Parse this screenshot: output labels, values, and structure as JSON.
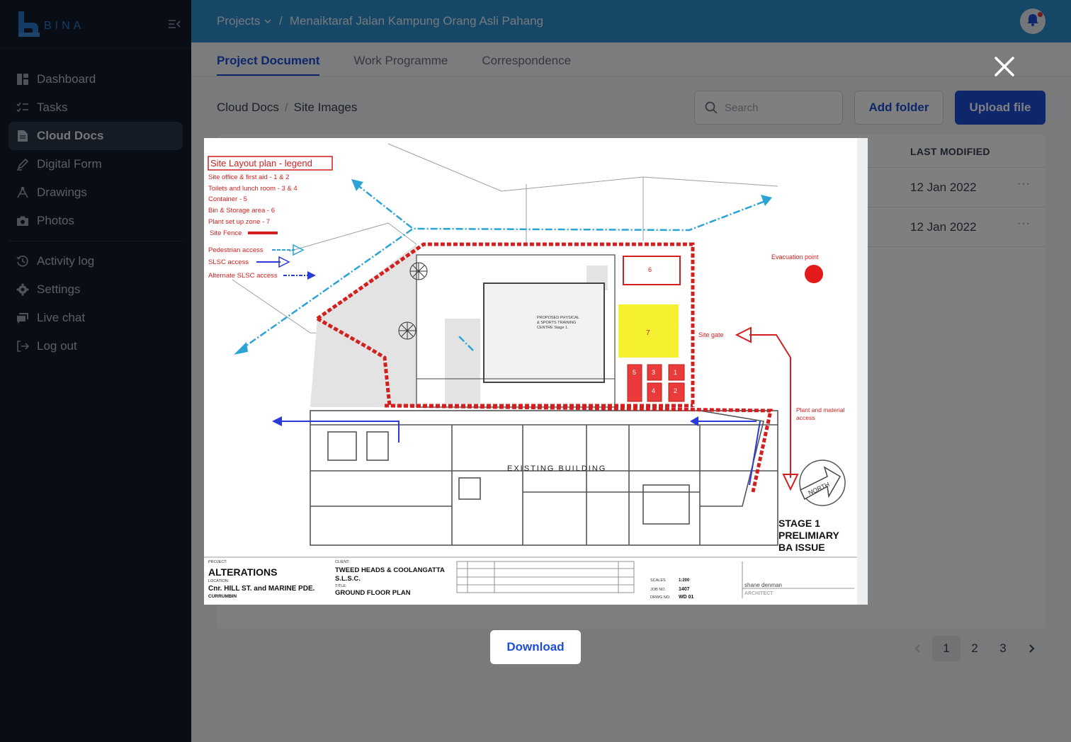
{
  "app": {
    "logo_text": "BINA"
  },
  "sidebar": {
    "items": [
      {
        "label": "Dashboard",
        "icon": "dashboard-icon",
        "active": false
      },
      {
        "label": "Tasks",
        "icon": "tasks-icon",
        "active": false
      },
      {
        "label": "Cloud Docs",
        "icon": "document-icon",
        "active": true
      },
      {
        "label": "Digital Form",
        "icon": "pen-icon",
        "active": false
      },
      {
        "label": "Drawings",
        "icon": "drawing-icon",
        "active": false
      },
      {
        "label": "Photos",
        "icon": "camera-icon",
        "active": false
      }
    ],
    "items2": [
      {
        "label": "Activity log",
        "icon": "history-icon"
      },
      {
        "label": "Settings",
        "icon": "gear-icon"
      },
      {
        "label": "Live chat",
        "icon": "chat-icon"
      },
      {
        "label": "Log out",
        "icon": "logout-icon"
      }
    ]
  },
  "topbar": {
    "projects_label": "Projects",
    "separator": "/",
    "project_name": "Menaiktaraf Jalan Kampung Orang Asli Pahang"
  },
  "tabs": [
    {
      "label": "Project Document",
      "active": true
    },
    {
      "label": "Work Programme",
      "active": false
    },
    {
      "label": "Correspondence",
      "active": false
    }
  ],
  "breadcrumb": {
    "root": "Cloud Docs",
    "separator": "/",
    "current": "Site Images"
  },
  "search": {
    "placeholder": "Search"
  },
  "toolbar": {
    "add_folder": "Add folder",
    "upload_file": "Upload file"
  },
  "table": {
    "last_modified_header": "LAST MODIFIED",
    "rows": [
      {
        "modified": "12 Jan 2022",
        "menu": "···"
      },
      {
        "modified": "12 Jan 2022",
        "menu": "···"
      }
    ]
  },
  "pagination": {
    "pages": [
      "1",
      "2",
      "3"
    ],
    "current": "1"
  },
  "viewer": {
    "download_label": "Download",
    "drawing": {
      "legend_title": "Site Layout plan - legend",
      "legend_items": [
        "Site office & first aid - 1 & 2",
        "Toilets and lunch room - 3 & 4",
        "Container - 5",
        "Bin & Storage area - 6",
        "Plant set up zone - 7",
        "Site Fence"
      ],
      "access_items": [
        "Pedestrian access",
        "SLSC access",
        "Alternate SLSC access"
      ],
      "evacuation": "Evacuation point",
      "site_gate": "Site gate",
      "plant_access_1": "Plant and material",
      "plant_access_2": "access",
      "existing_building": "EXISTING BUILDING",
      "north": "NORTH",
      "stage_1": "STAGE  1",
      "stage_2": "PRELIMIARY",
      "stage_3": "BA ISSUE",
      "project_label": "PROJECT:",
      "project": "ALTERATIONS",
      "location_label": "LOCATION:",
      "location": "Cnr. HILL ST. and MARINE PDE.",
      "suburb": "CURRUMBIN",
      "client_label": "CLIENT:",
      "client_1": "TWEED HEADS & COOLANGATTA",
      "client_2": "S.L.S.C.",
      "title_label": "TITLE:",
      "title": "GROUND FLOOR PLAN",
      "architect": "shane denman",
      "architect_sub": "ARCHITECT",
      "drwg_no": "WD 01",
      "job_no": "1407",
      "scale": "1:200"
    }
  },
  "colors": {
    "topbar": "#2f8fcc",
    "sidebar": "#101b2d",
    "accent": "#1d4ed8",
    "fence": "#d21f1f",
    "access": "#2aa3d6"
  }
}
